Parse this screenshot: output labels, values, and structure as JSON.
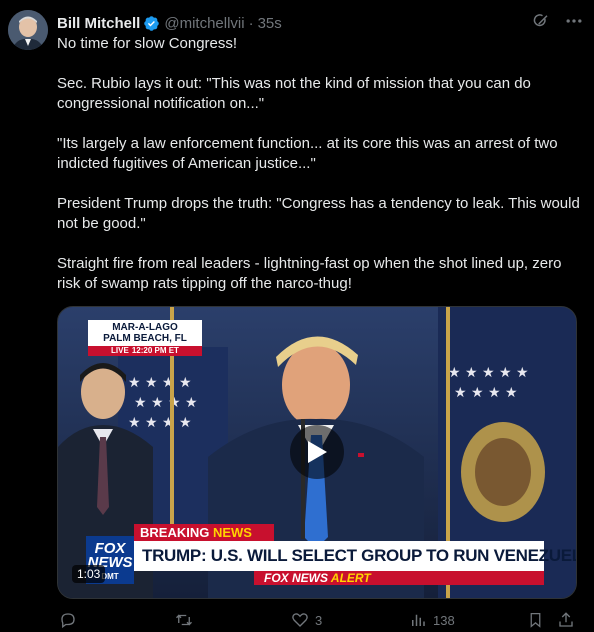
{
  "post": {
    "author_name": "Bill Mitchell",
    "handle": "@mitchellvii",
    "separator": "·",
    "time": "35s",
    "paragraphs": [
      "No time for slow Congress!",
      "Sec. Rubio lays it out: \"This was not the kind of mission that you can do congressional notification on...\"",
      "\"Its largely a law enforcement function... at its core this was an arrest of two indicted fugitives of American justice...\"",
      "President Trump drops the truth: \"Congress has a tendency to leak. This would not be good.\"",
      "Straight fire from real leaders - lightning-fast op when the shot lined up, zero risk of swamp rats tipping off the narco-thug!"
    ]
  },
  "video": {
    "location_line1": "MAR-A-LAGO",
    "location_line2": "PALM BEACH, FL",
    "live_label": "LIVE",
    "live_time": "12:20 PM ET",
    "breaking_prefix": "BREAKING",
    "breaking_suffix": "NEWS",
    "headline": "TRUMP: U.S. WILL SELECT GROUP TO RUN VENEZUELA",
    "network_line1": "FOX",
    "network_line2": "NEWS",
    "network_line3": "DMT",
    "strip_prefix": "FOX NEWS",
    "strip_suffix": "ALERT",
    "duration": "1:03"
  },
  "actions": {
    "reply_count": "",
    "repost_count": "",
    "like_count": "3",
    "views_count": "138"
  },
  "icons": {
    "verified": "verified-badge-icon",
    "grok": "grok-icon",
    "more": "more-icon",
    "reply": "reply-icon",
    "repost": "repost-icon",
    "like": "like-icon",
    "views": "views-icon",
    "bookmark": "bookmark-icon",
    "share": "share-icon"
  },
  "colors": {
    "background": "#000000",
    "text": "#e7e9ea",
    "muted": "#71767b",
    "verified": "#1d9bf0",
    "fox_red": "#c8102e",
    "fox_blue": "#0b3a8f"
  }
}
